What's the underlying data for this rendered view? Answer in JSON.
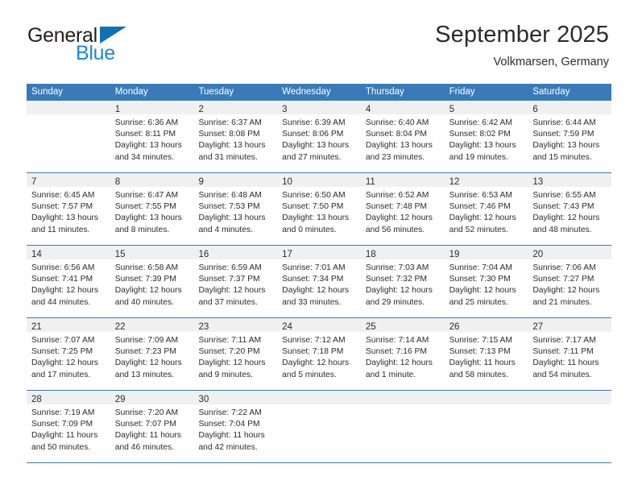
{
  "logo": {
    "word_dark": "General",
    "word_blue": "Blue",
    "triangle": "triangle-icon"
  },
  "header": {
    "title": "September 2025",
    "subtitle": "Volkmarsen, Germany"
  },
  "colors": {
    "header_blue": "#3a7ab8",
    "logo_blue": "#1d87d8",
    "logo_dark": "#231f20",
    "daynum_band": "#f0f0f0",
    "text": "#2b2b2b"
  },
  "calendar": {
    "weekday_headers": [
      "Sunday",
      "Monday",
      "Tuesday",
      "Wednesday",
      "Thursday",
      "Friday",
      "Saturday"
    ],
    "labels": {
      "sunrise": "Sunrise:",
      "sunset": "Sunset:",
      "daylight": "Daylight:"
    },
    "weeks": [
      [
        {
          "day": "",
          "empty": true,
          "sunrise": "",
          "sunset": "",
          "daylight_1": "",
          "daylight_2": ""
        },
        {
          "day": "1",
          "empty": false,
          "sunrise": "Sunrise: 6:36 AM",
          "sunset": "Sunset: 8:11 PM",
          "daylight_1": "Daylight: 13 hours",
          "daylight_2": "and 34 minutes."
        },
        {
          "day": "2",
          "empty": false,
          "sunrise": "Sunrise: 6:37 AM",
          "sunset": "Sunset: 8:08 PM",
          "daylight_1": "Daylight: 13 hours",
          "daylight_2": "and 31 minutes."
        },
        {
          "day": "3",
          "empty": false,
          "sunrise": "Sunrise: 6:39 AM",
          "sunset": "Sunset: 8:06 PM",
          "daylight_1": "Daylight: 13 hours",
          "daylight_2": "and 27 minutes."
        },
        {
          "day": "4",
          "empty": false,
          "sunrise": "Sunrise: 6:40 AM",
          "sunset": "Sunset: 8:04 PM",
          "daylight_1": "Daylight: 13 hours",
          "daylight_2": "and 23 minutes."
        },
        {
          "day": "5",
          "empty": false,
          "sunrise": "Sunrise: 6:42 AM",
          "sunset": "Sunset: 8:02 PM",
          "daylight_1": "Daylight: 13 hours",
          "daylight_2": "and 19 minutes."
        },
        {
          "day": "6",
          "empty": false,
          "sunrise": "Sunrise: 6:44 AM",
          "sunset": "Sunset: 7:59 PM",
          "daylight_1": "Daylight: 13 hours",
          "daylight_2": "and 15 minutes."
        }
      ],
      [
        {
          "day": "7",
          "empty": false,
          "sunrise": "Sunrise: 6:45 AM",
          "sunset": "Sunset: 7:57 PM",
          "daylight_1": "Daylight: 13 hours",
          "daylight_2": "and 11 minutes."
        },
        {
          "day": "8",
          "empty": false,
          "sunrise": "Sunrise: 6:47 AM",
          "sunset": "Sunset: 7:55 PM",
          "daylight_1": "Daylight: 13 hours",
          "daylight_2": "and 8 minutes."
        },
        {
          "day": "9",
          "empty": false,
          "sunrise": "Sunrise: 6:48 AM",
          "sunset": "Sunset: 7:53 PM",
          "daylight_1": "Daylight: 13 hours",
          "daylight_2": "and 4 minutes."
        },
        {
          "day": "10",
          "empty": false,
          "sunrise": "Sunrise: 6:50 AM",
          "sunset": "Sunset: 7:50 PM",
          "daylight_1": "Daylight: 13 hours",
          "daylight_2": "and 0 minutes."
        },
        {
          "day": "11",
          "empty": false,
          "sunrise": "Sunrise: 6:52 AM",
          "sunset": "Sunset: 7:48 PM",
          "daylight_1": "Daylight: 12 hours",
          "daylight_2": "and 56 minutes."
        },
        {
          "day": "12",
          "empty": false,
          "sunrise": "Sunrise: 6:53 AM",
          "sunset": "Sunset: 7:46 PM",
          "daylight_1": "Daylight: 12 hours",
          "daylight_2": "and 52 minutes."
        },
        {
          "day": "13",
          "empty": false,
          "sunrise": "Sunrise: 6:55 AM",
          "sunset": "Sunset: 7:43 PM",
          "daylight_1": "Daylight: 12 hours",
          "daylight_2": "and 48 minutes."
        }
      ],
      [
        {
          "day": "14",
          "empty": false,
          "sunrise": "Sunrise: 6:56 AM",
          "sunset": "Sunset: 7:41 PM",
          "daylight_1": "Daylight: 12 hours",
          "daylight_2": "and 44 minutes."
        },
        {
          "day": "15",
          "empty": false,
          "sunrise": "Sunrise: 6:58 AM",
          "sunset": "Sunset: 7:39 PM",
          "daylight_1": "Daylight: 12 hours",
          "daylight_2": "and 40 minutes."
        },
        {
          "day": "16",
          "empty": false,
          "sunrise": "Sunrise: 6:59 AM",
          "sunset": "Sunset: 7:37 PM",
          "daylight_1": "Daylight: 12 hours",
          "daylight_2": "and 37 minutes."
        },
        {
          "day": "17",
          "empty": false,
          "sunrise": "Sunrise: 7:01 AM",
          "sunset": "Sunset: 7:34 PM",
          "daylight_1": "Daylight: 12 hours",
          "daylight_2": "and 33 minutes."
        },
        {
          "day": "18",
          "empty": false,
          "sunrise": "Sunrise: 7:03 AM",
          "sunset": "Sunset: 7:32 PM",
          "daylight_1": "Daylight: 12 hours",
          "daylight_2": "and 29 minutes."
        },
        {
          "day": "19",
          "empty": false,
          "sunrise": "Sunrise: 7:04 AM",
          "sunset": "Sunset: 7:30 PM",
          "daylight_1": "Daylight: 12 hours",
          "daylight_2": "and 25 minutes."
        },
        {
          "day": "20",
          "empty": false,
          "sunrise": "Sunrise: 7:06 AM",
          "sunset": "Sunset: 7:27 PM",
          "daylight_1": "Daylight: 12 hours",
          "daylight_2": "and 21 minutes."
        }
      ],
      [
        {
          "day": "21",
          "empty": false,
          "sunrise": "Sunrise: 7:07 AM",
          "sunset": "Sunset: 7:25 PM",
          "daylight_1": "Daylight: 12 hours",
          "daylight_2": "and 17 minutes."
        },
        {
          "day": "22",
          "empty": false,
          "sunrise": "Sunrise: 7:09 AM",
          "sunset": "Sunset: 7:23 PM",
          "daylight_1": "Daylight: 12 hours",
          "daylight_2": "and 13 minutes."
        },
        {
          "day": "23",
          "empty": false,
          "sunrise": "Sunrise: 7:11 AM",
          "sunset": "Sunset: 7:20 PM",
          "daylight_1": "Daylight: 12 hours",
          "daylight_2": "and 9 minutes."
        },
        {
          "day": "24",
          "empty": false,
          "sunrise": "Sunrise: 7:12 AM",
          "sunset": "Sunset: 7:18 PM",
          "daylight_1": "Daylight: 12 hours",
          "daylight_2": "and 5 minutes."
        },
        {
          "day": "25",
          "empty": false,
          "sunrise": "Sunrise: 7:14 AM",
          "sunset": "Sunset: 7:16 PM",
          "daylight_1": "Daylight: 12 hours",
          "daylight_2": "and 1 minute."
        },
        {
          "day": "26",
          "empty": false,
          "sunrise": "Sunrise: 7:15 AM",
          "sunset": "Sunset: 7:13 PM",
          "daylight_1": "Daylight: 11 hours",
          "daylight_2": "and 58 minutes."
        },
        {
          "day": "27",
          "empty": false,
          "sunrise": "Sunrise: 7:17 AM",
          "sunset": "Sunset: 7:11 PM",
          "daylight_1": "Daylight: 11 hours",
          "daylight_2": "and 54 minutes."
        }
      ],
      [
        {
          "day": "28",
          "empty": false,
          "sunrise": "Sunrise: 7:19 AM",
          "sunset": "Sunset: 7:09 PM",
          "daylight_1": "Daylight: 11 hours",
          "daylight_2": "and 50 minutes."
        },
        {
          "day": "29",
          "empty": false,
          "sunrise": "Sunrise: 7:20 AM",
          "sunset": "Sunset: 7:07 PM",
          "daylight_1": "Daylight: 11 hours",
          "daylight_2": "and 46 minutes."
        },
        {
          "day": "30",
          "empty": false,
          "sunrise": "Sunrise: 7:22 AM",
          "sunset": "Sunset: 7:04 PM",
          "daylight_1": "Daylight: 11 hours",
          "daylight_2": "and 42 minutes."
        },
        {
          "day": "",
          "empty": true,
          "sunrise": "",
          "sunset": "",
          "daylight_1": "",
          "daylight_2": ""
        },
        {
          "day": "",
          "empty": true,
          "sunrise": "",
          "sunset": "",
          "daylight_1": "",
          "daylight_2": ""
        },
        {
          "day": "",
          "empty": true,
          "sunrise": "",
          "sunset": "",
          "daylight_1": "",
          "daylight_2": ""
        },
        {
          "day": "",
          "empty": true,
          "sunrise": "",
          "sunset": "",
          "daylight_1": "",
          "daylight_2": ""
        }
      ]
    ]
  }
}
